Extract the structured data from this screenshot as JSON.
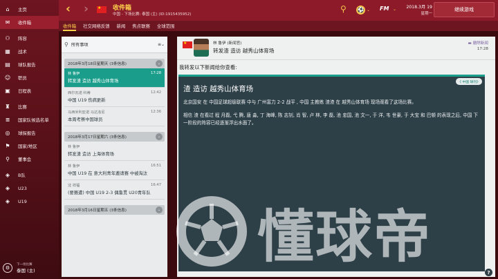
{
  "sidebar": {
    "items": [
      {
        "label": "主页",
        "icon": "home-icon",
        "glyph": "⌂"
      },
      {
        "label": "收件箱",
        "icon": "inbox-icon",
        "glyph": "✉",
        "active": true
      },
      {
        "label": "阵容",
        "icon": "squad-icon",
        "glyph": "⚇"
      },
      {
        "label": "战术",
        "icon": "tactics-icon",
        "glyph": "▦"
      },
      {
        "label": "球队报告",
        "icon": "report-icon",
        "glyph": "▤"
      },
      {
        "label": "职员",
        "icon": "staff-icon",
        "glyph": "☺"
      },
      {
        "label": "日程表",
        "icon": "calendar-icon",
        "glyph": "▣"
      },
      {
        "label": "比赛",
        "icon": "competition-icon",
        "glyph": "♜"
      },
      {
        "label": "国家队候选名单",
        "icon": "shortlist-icon",
        "glyph": "≣"
      },
      {
        "label": "球探报告",
        "icon": "scouting-icon",
        "glyph": "◎"
      },
      {
        "label": "国家/地区",
        "icon": "nation-icon",
        "glyph": "⚑"
      },
      {
        "label": "董事会",
        "icon": "board-icon",
        "glyph": "⚲"
      },
      {
        "label": "B队",
        "icon": "team-icon",
        "glyph": "◈"
      },
      {
        "label": "U23",
        "icon": "team-icon",
        "glyph": "◈"
      },
      {
        "label": "U19",
        "icon": "team-icon",
        "glyph": "◈"
      }
    ],
    "next_match": {
      "label": "下一场比赛",
      "opponent": "泰国 (主)",
      "badge_glyph": "⚙"
    }
  },
  "topbar": {
    "back_glyph": "‹",
    "forward_glyph": "›",
    "title": "收件箱",
    "subtitle": "中国 - 下场比赛: 泰国 (主) (ID:1915435952)",
    "search_glyph": "⚲",
    "manager_glyph": "⚽",
    "fm_label": "FM",
    "chevron_glyph": "⌄",
    "date": "2018.3月 19",
    "weekday": "星期一",
    "continue_label": "继续游戏"
  },
  "tabs": [
    "收件箱",
    "社交网络反馈",
    "新闻",
    "焦点联赛",
    "全球范围"
  ],
  "inbox": {
    "search_glyph": "⚲",
    "filter_label": "所有事项",
    "menu_glyph": "≡⌄",
    "groups": [
      {
        "header": "2018年3月18日星期天 (3条信息)",
        "messages": [
          {
            "sender": "林 鲁伊",
            "time": "17:28",
            "subject": "转发渣 造访 越秀山体育场",
            "selected": true
          },
          {
            "sender": "西尔瓦诺 科蒂",
            "time": "12:42",
            "subject": "中国 U19 伤病更新",
            "selected": false
          },
          {
            "sender": "马西米利亚诺 马达洛尼",
            "time": "12:36",
            "subject": "本周考察中国球员",
            "selected": false
          }
        ]
      },
      {
        "header": "2018年3月17日星期六 (3条信息)",
        "messages": [
          {
            "sender": "林 鲁伊",
            "time": "",
            "subject": "转发渣 造访 上海体育场",
            "selected": false
          },
          {
            "sender": "林 鲁伊",
            "time": "16:51",
            "subject": "中国 U19 在 意大利青年邀请赛 中被淘汰",
            "selected": false
          },
          {
            "sender": "沈 祥福",
            "time": "16:47",
            "subject": "(要赛遭) 中国 U19 2-3 偶鲁贯 U20青年队",
            "selected": false
          }
        ]
      },
      {
        "header": "2018年3月16日星期五 (3条信息)",
        "messages": []
      }
    ]
  },
  "reader": {
    "sender": "林 鲁伊 (新闻官)",
    "subject": "转发渣 造访 越秀山体育场",
    "action": "撤除新闻",
    "time": "17:28",
    "intro": "我转发以下新闻给你查看:",
    "news": {
      "tag": "《 中国 球刊》",
      "title": "渣 造访 越秀山体育场",
      "p1": "北京国安 在 中国足球超级联赛 中与 广州富力 2-2 战平 , 中国 主教练 渣渣 在 越秀山体育场 现场观看了这场比赛。",
      "p2": "相信 渣 在看过 程 月磊, 弋 腾, 唐 淼, 丁 海峰, 陈 志钊, 肖 智, 卢 林, 李 磊, 池 忠国, 池 文一, 于 洋, 韦 世豪, 于 大宝 和 巴顿 的表现之后, 中国 下一阶段的阵容已经逐渐浮出水面了。"
    }
  },
  "help_label": "?",
  "watermark": {
    "text": "懂球帝",
    "icon": "dongqiudi-logo-icon"
  },
  "colors": {
    "brand_red": "#8c1a28",
    "accent_gold": "#ffd24d",
    "selection_teal": "#1a9e8b",
    "card_dark": "#2d3f47"
  }
}
